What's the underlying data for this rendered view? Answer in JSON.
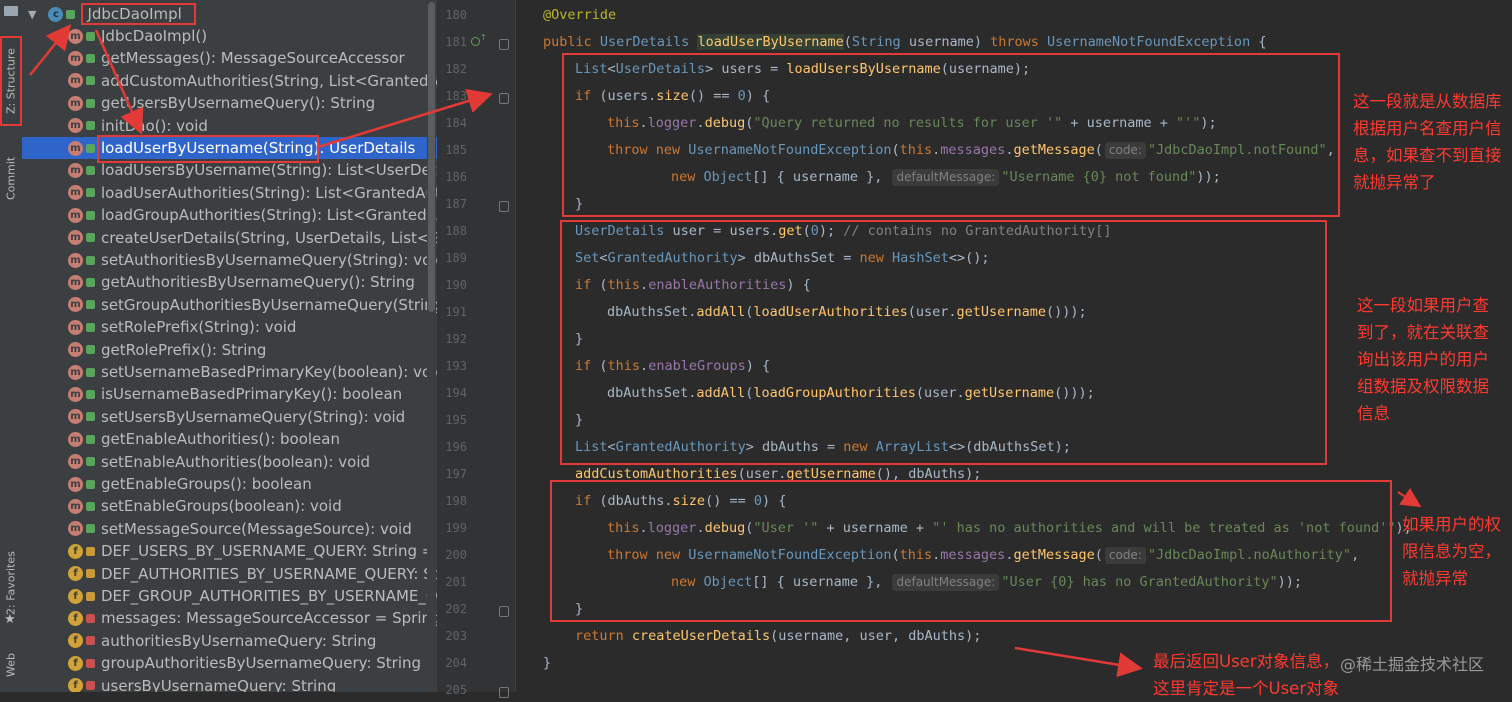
{
  "toolbar": {
    "structure_label": "Z: Structure",
    "commit_label": "Commit",
    "favorites_label": "2: Favorites",
    "web_label": "Web"
  },
  "structure": {
    "class_name": "JdbcDaoImpl",
    "items": [
      {
        "label": "JdbcDaoImpl()",
        "kind": "method",
        "access": "public"
      },
      {
        "label": "getMessages(): MessageSourceAccessor",
        "kind": "method",
        "access": "public"
      },
      {
        "label": "addCustomAuthorities(String, List<GrantedAuthority>)",
        "kind": "method",
        "access": "public"
      },
      {
        "label": "getUsersByUsernameQuery(): String",
        "kind": "method",
        "access": "public"
      },
      {
        "label": "initDao(): void",
        "kind": "method",
        "access": "public"
      },
      {
        "label": "loadUserByUsername(String): UserDetails",
        "kind": "method",
        "access": "public",
        "selected": true
      },
      {
        "label": "loadUsersByUsername(String): List<UserDetails>",
        "kind": "method",
        "access": "public"
      },
      {
        "label": "loadUserAuthorities(String): List<GrantedAuthority>",
        "kind": "method",
        "access": "public"
      },
      {
        "label": "loadGroupAuthorities(String): List<GrantedAuthority>",
        "kind": "method",
        "access": "public"
      },
      {
        "label": "createUserDetails(String, UserDetails, List<GrantedAuthority>)",
        "kind": "method",
        "access": "public"
      },
      {
        "label": "setAuthoritiesByUsernameQuery(String): void",
        "kind": "method",
        "access": "public"
      },
      {
        "label": "getAuthoritiesByUsernameQuery(): String",
        "kind": "method",
        "access": "public"
      },
      {
        "label": "setGroupAuthoritiesByUsernameQuery(String): void",
        "kind": "method",
        "access": "public"
      },
      {
        "label": "setRolePrefix(String): void",
        "kind": "method",
        "access": "public"
      },
      {
        "label": "getRolePrefix(): String",
        "kind": "method",
        "access": "public"
      },
      {
        "label": "setUsernameBasedPrimaryKey(boolean): void",
        "kind": "method",
        "access": "public"
      },
      {
        "label": "isUsernameBasedPrimaryKey(): boolean",
        "kind": "method",
        "access": "public"
      },
      {
        "label": "setUsersByUsernameQuery(String): void",
        "kind": "method",
        "access": "public"
      },
      {
        "label": "getEnableAuthorities(): boolean",
        "kind": "method",
        "access": "public"
      },
      {
        "label": "setEnableAuthorities(boolean): void",
        "kind": "method",
        "access": "public"
      },
      {
        "label": "getEnableGroups(): boolean",
        "kind": "method",
        "access": "public"
      },
      {
        "label": "setEnableGroups(boolean): void",
        "kind": "method",
        "access": "public"
      },
      {
        "label": "setMessageSource(MessageSource): void",
        "kind": "method",
        "access": "public"
      },
      {
        "label": "DEF_USERS_BY_USERNAME_QUERY: String = \"se",
        "kind": "field",
        "access": "static"
      },
      {
        "label": "DEF_AUTHORITIES_BY_USERNAME_QUERY: String",
        "kind": "field",
        "access": "static"
      },
      {
        "label": "DEF_GROUP_AUTHORITIES_BY_USERNAME_QUERY",
        "kind": "field",
        "access": "static"
      },
      {
        "label": "messages: MessageSourceAccessor = SpringSecu",
        "kind": "field",
        "access": "private"
      },
      {
        "label": "authoritiesByUsernameQuery: String",
        "kind": "field",
        "access": "private"
      },
      {
        "label": "groupAuthoritiesByUsernameQuery: String",
        "kind": "field",
        "access": "private"
      },
      {
        "label": "usersByUsernameQuery: String",
        "kind": "field",
        "access": "private"
      }
    ]
  },
  "editor": {
    "line_numbers": [
      "180",
      "181",
      "182",
      "183",
      "184",
      "185",
      "186",
      "187",
      "188",
      "189",
      "190",
      "191",
      "192",
      "193",
      "194",
      "195",
      "196",
      "197",
      "198",
      "199",
      "200",
      "201",
      "202",
      "203",
      "204",
      "205"
    ]
  },
  "annotations": {
    "note1": "这一段就是从数据库根据用户名查用户信息，如果查不到直接就抛异常了",
    "note2": "这一段如果用户查到了，就在关联查询出该用户的用户组数据及权限数据信息",
    "note3": "如果用户的权限信息为空，就抛异常",
    "note4": "最后返回User对象信息，这里肯定是一个User对象",
    "watermark": "@稀土掘金技术社区"
  },
  "colors": {
    "annotation_red": "#e23a36",
    "selection_blue": "#2f65ca",
    "keyword": "#cc7832",
    "method": "#ffc66d",
    "string": "#6a8759",
    "field": "#9876aa"
  }
}
